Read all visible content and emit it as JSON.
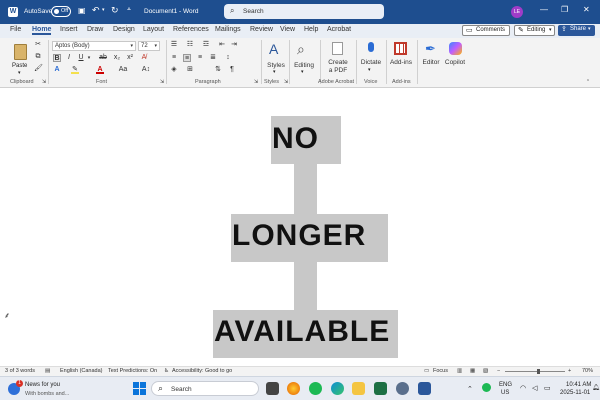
{
  "titlebar": {
    "autosave_label": "AutoSave",
    "autosave_state": "Off",
    "doc_title": "Document1 - Word",
    "search_placeholder": "Search",
    "avatar_initials": "LE"
  },
  "menu": {
    "tabs": [
      "File",
      "Home",
      "Insert",
      "Draw",
      "Design",
      "Layout",
      "References",
      "Mailings",
      "Review",
      "View",
      "Help",
      "Acrobat"
    ],
    "active_tab": "Home",
    "comments_label": "Comments",
    "editing_label": "Editing",
    "share_label": "Share"
  },
  "ribbon": {
    "paste_label": "Paste",
    "font_name": "Aptos (Body)",
    "font_size": "72",
    "styles_label": "Styles",
    "editing_label": "Editing",
    "create_pdf_label1": "Create",
    "create_pdf_label2": "a PDF",
    "dictate_label": "Dictate",
    "addins_label": "Add-ins",
    "editor_label": "Editor",
    "copilot_label": "Copilot",
    "groups": {
      "clipboard": "Clipboard",
      "font": "Font",
      "paragraph": "Paragraph",
      "styles": "Styles",
      "adobe": "Adobe Acrobat",
      "voice": "Voice",
      "addins": "Add-ins"
    }
  },
  "document": {
    "words": [
      "NO",
      "LONGER",
      "AVAILABLE"
    ],
    "fill_color": "#c8c8c8"
  },
  "status": {
    "word_count": "3 of 3 words",
    "language": "English (Canada)",
    "predictions": "Text Predictions: On",
    "accessibility": "Accessibility: Good to go",
    "focus": "Focus",
    "zoom": "70%"
  },
  "taskbar": {
    "news_badge": "1",
    "news_title": "News for you",
    "news_subtitle": "With bombs and...",
    "search_placeholder": "Search",
    "lang1": "ENG",
    "lang2": "US",
    "time": "10:41 AM",
    "date": "2025-11-01"
  },
  "colors": {
    "title_blue": "#1e4e8f",
    "accent": "#2b579a",
    "avatar": "#a03cc8"
  }
}
